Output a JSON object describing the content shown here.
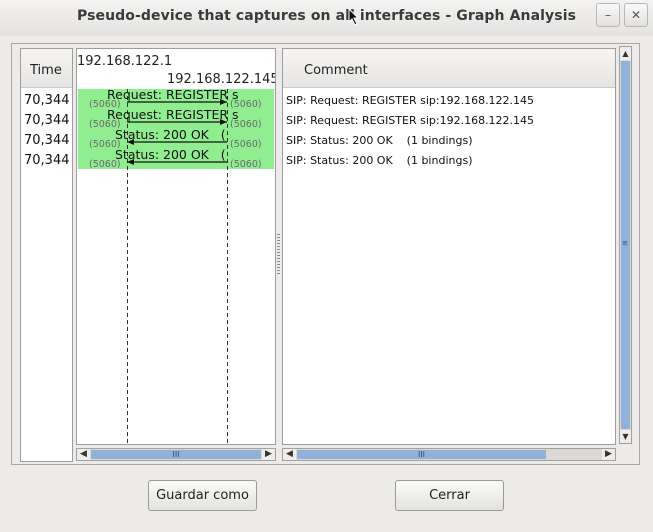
{
  "window": {
    "title": "Pseudo-device that captures on all interfaces - Graph Analysis",
    "minimize_glyph": "–",
    "close_glyph": "✕"
  },
  "time_panel": {
    "header": "Time",
    "rows": [
      "70,344",
      "70,344",
      "70,344",
      "70,344"
    ]
  },
  "graph": {
    "node_left": "192.168.122.1",
    "node_right": "192.168.122.145",
    "arrows": [
      {
        "label": "Request: REGISTER s",
        "src_port": "(5060)",
        "dst_port": "(5060)",
        "direction": "right"
      },
      {
        "label": "Request: REGISTER s",
        "src_port": "(5060)",
        "dst_port": "(5060)",
        "direction": "right"
      },
      {
        "label": "Status: 200 OK   (",
        "src_port": "(5060)",
        "dst_port": "(5060)",
        "direction": "left"
      },
      {
        "label": "Status: 200 OK   (",
        "src_port": "(5060)",
        "dst_port": "(5060)",
        "direction": "left"
      }
    ],
    "highlight_color": "#90ee90"
  },
  "comment_panel": {
    "header": "Comment",
    "rows": [
      "SIP: Request: REGISTER sip:192.168.122.145",
      "SIP: Request: REGISTER sip:192.168.122.145",
      "SIP: Status: 200 OK    (1 bindings)",
      "SIP: Status: 200 OK    (1 bindings)"
    ]
  },
  "scroll": {
    "left_arrow": "◀",
    "right_arrow": "▶",
    "up_arrow": "▲",
    "down_arrow": "▼",
    "grip": "III"
  },
  "buttons": {
    "save_as": "Guardar como",
    "close": "Cerrar"
  }
}
